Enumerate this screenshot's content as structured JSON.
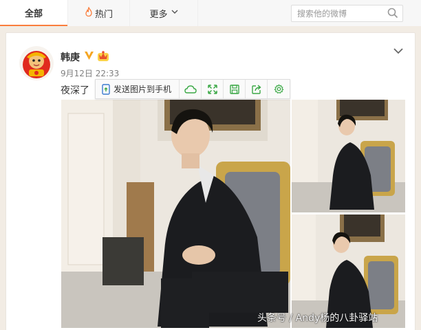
{
  "tabs": {
    "all": "全部",
    "hot": "热门",
    "more": "更多"
  },
  "search": {
    "placeholder": "搜索他的微博"
  },
  "post": {
    "username": "韩庚",
    "timestamp": "9月12日 22:33",
    "text": "夜深了",
    "photo_count": 3
  },
  "toolbar": {
    "send_label": "发送图片到手机",
    "icons": [
      "cloud-icon",
      "expand-icon",
      "save-icon",
      "share-icon",
      "settings-icon"
    ]
  },
  "watermark": "头条号 / Andy杨的八卦驿站",
  "colors": {
    "accent": "#fa7d3c",
    "vip": "#f5a623",
    "toolbar_icon": "#3aa845"
  }
}
